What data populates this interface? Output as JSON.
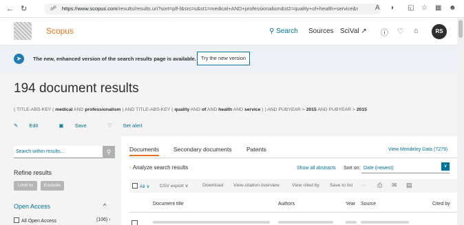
{
  "browser": {
    "url_host": "https://www.scopus.com",
    "url_path": "/results/results.uri?sort=plf-f&src=s&st1=medical+AND+professionalism&st2=quality+of+health+service&sid=7fc60d..."
  },
  "header": {
    "brand": "Scopus",
    "nav_search": "Search",
    "nav_sources": "Sources",
    "nav_scival": "SciVal ↗",
    "avatar_initials": "RS"
  },
  "banner": {
    "text": "The new, enhanced version of the search results page is available.",
    "button": "Try the new version"
  },
  "results": {
    "title": "194 document results",
    "query": {
      "p1": "( TITLE-ABS-KEY ( ",
      "t1": "medical",
      "p2": " AND ",
      "t2": "professionalism",
      "p3": " ) AND TITLE-ABS-KEY ( ",
      "t3": "quality",
      "p4": " AND ",
      "t4": "of",
      "p5": " AND ",
      "t5": "health",
      "p6": " AND ",
      "t6": "service",
      "p7": " ) ) AND PUBYEAR > ",
      "t7": "2015",
      "p8": " AND PUBYEAR > ",
      "t8": "2015"
    },
    "edit": "Edit",
    "save": "Save",
    "set_alert": "Set alert"
  },
  "left_panel": {
    "search_placeholder": "Search within results...",
    "refine": "Refine results",
    "limit_to": "Limit to",
    "exclude": "Exclude",
    "open_access": "Open Access",
    "all_open_access": "All Open Access",
    "all_open_access_count": "(106) ›"
  },
  "right_panel": {
    "tabs": [
      "Documents",
      "Secondary documents",
      "Patents"
    ],
    "mendeley": "View Mendeley Data (7279)",
    "analyze": "Analyze search results",
    "show_abstracts": "Show all abstracts",
    "sort_on": "Sort on:",
    "sort_value": "Date (newest)",
    "toolbar": {
      "all": "All ∨",
      "csv_export": "CSV export ∨",
      "download": "Download",
      "citation_overview": "View citation overview",
      "cited_by": "View cited by",
      "save_to_list": "Save to list",
      "more": "···"
    },
    "columns": {
      "title": "Document title",
      "authors": "Authors",
      "year": "Year",
      "source": "Source",
      "cited_by": "Cited by"
    }
  },
  "colors": {
    "accent_orange": "#e9711c",
    "link_teal": "#007398",
    "banner_bg": "#eef1f6"
  }
}
